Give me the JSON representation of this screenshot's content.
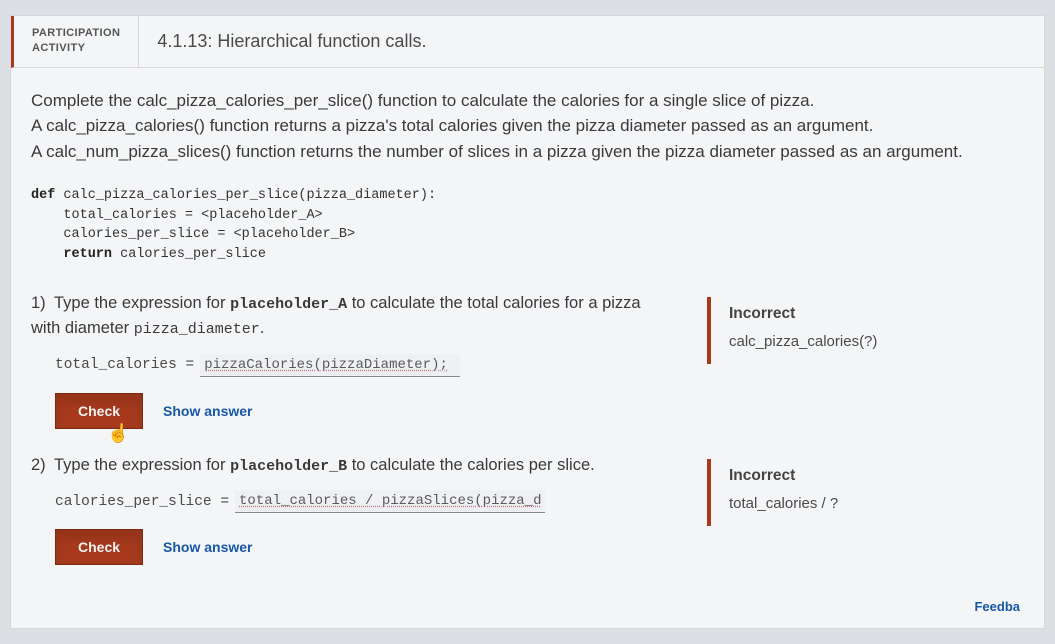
{
  "header": {
    "type_line1": "PARTICIPATION",
    "type_line2": "ACTIVITY",
    "title": "4.1.13: Hierarchical function calls."
  },
  "description": "Complete the calc_pizza_calories_per_slice() function to calculate the calories for a single slice of pizza.\nA calc_pizza_calories() function returns a pizza's total calories given the pizza diameter passed as an argument.\nA calc_num_pizza_slices() function returns the number of slices in a pizza given the pizza diameter passed as an argument.",
  "code": {
    "l1a": "def",
    "l1b": " calc_pizza_calories_per_slice(pizza_diameter):",
    "l2": "    total_calories = <placeholder_A>",
    "l3": "    calories_per_slice = <placeholder_B>",
    "l4a": "    return",
    "l4b": " calories_per_slice"
  },
  "q1": {
    "num": "1)",
    "text_pre": "Type the expression for ",
    "ph": "placeholder_A",
    "text_mid": " to calculate the total calories for a pizza with diameter ",
    "var": "pizza_diameter",
    "text_post": ".",
    "lhs": "total_calories = ",
    "input_value": "pizzaCalories(pizzaDiameter);",
    "check": "Check",
    "show": "Show answer",
    "feedback_title": "Incorrect",
    "feedback_text": "calc_pizza_calories(?)"
  },
  "q2": {
    "num": "2)",
    "text_pre": "Type the expression for ",
    "ph": "placeholder_B",
    "text_mid": " to calculate the calories per slice.",
    "lhs": "calories_per_slice = ",
    "input_value": "total_calories / pizzaSlices(pizza_diameter)",
    "check": "Check",
    "show": "Show answer",
    "feedback_title": "Incorrect",
    "feedback_text": "total_calories / ?"
  },
  "footer": {
    "feedback_link": "Feedba"
  }
}
